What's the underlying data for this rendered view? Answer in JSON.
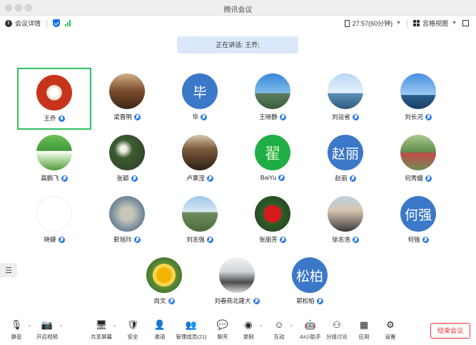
{
  "window": {
    "title": "腾讯会议"
  },
  "infobar": {
    "meeting_details": "会议详情",
    "timer": "27:57(60分钟)",
    "view_mode": "宫格视图"
  },
  "banner": {
    "speaking": "正在讲话: 王乔;"
  },
  "participants": [
    {
      "name": "王乔",
      "avatar": "photo-a",
      "text": "",
      "active": true
    },
    {
      "name": "梁晋明",
      "avatar": "photo-b",
      "text": ""
    },
    {
      "name": "毕",
      "avatar": "txt",
      "text": "毕"
    },
    {
      "name": "王晓静",
      "avatar": "photo-c",
      "text": ""
    },
    {
      "name": "刘运省",
      "avatar": "photo-d",
      "text": ""
    },
    {
      "name": "刘长河",
      "avatar": "photo-e",
      "text": ""
    },
    {
      "name": "高鹏飞",
      "avatar": "photo-f",
      "text": ""
    },
    {
      "name": "张颖",
      "avatar": "photo-g",
      "text": ""
    },
    {
      "name": "卢栗滢",
      "avatar": "photo-h",
      "text": ""
    },
    {
      "name": "BaiYu",
      "avatar": "photo-i",
      "text": "翟"
    },
    {
      "name": "赵丽",
      "avatar": "txt",
      "text": "赵丽"
    },
    {
      "name": "何秀娥",
      "avatar": "photo-j",
      "text": ""
    },
    {
      "name": "晓婕",
      "avatar": "photo-k",
      "text": ""
    },
    {
      "name": "靳旭玲",
      "avatar": "photo-l",
      "text": ""
    },
    {
      "name": "刘志强",
      "avatar": "photo-m",
      "text": ""
    },
    {
      "name": "张丽芳",
      "avatar": "photo-n",
      "text": ""
    },
    {
      "name": "徐志浩",
      "avatar": "photo-o",
      "text": ""
    },
    {
      "name": "何强",
      "avatar": "txt",
      "text": "何强"
    },
    {
      "name": "尚文",
      "avatar": "photo-p",
      "text": ""
    },
    {
      "name": "刘春燕北建大",
      "avatar": "photo-q",
      "text": ""
    },
    {
      "name": "郭松柏",
      "avatar": "txt",
      "text": "松柏"
    }
  ],
  "toolbar": {
    "mute": "静音",
    "video": "开启视频",
    "share": "共享屏幕",
    "security": "安全",
    "invite": "邀请",
    "members": "管理成员(21)",
    "chat": "聊天",
    "record": "录制",
    "react": "互动",
    "ai": "AI小助手",
    "breakout": "分组讨论",
    "apps": "应用",
    "settings": "设置",
    "end": "结束会议"
  },
  "colors": {
    "accent": "#2a7be6",
    "active_border": "#2fbf5f",
    "end_red": "#e33333",
    "avatar_blue": "#3c78c8"
  }
}
